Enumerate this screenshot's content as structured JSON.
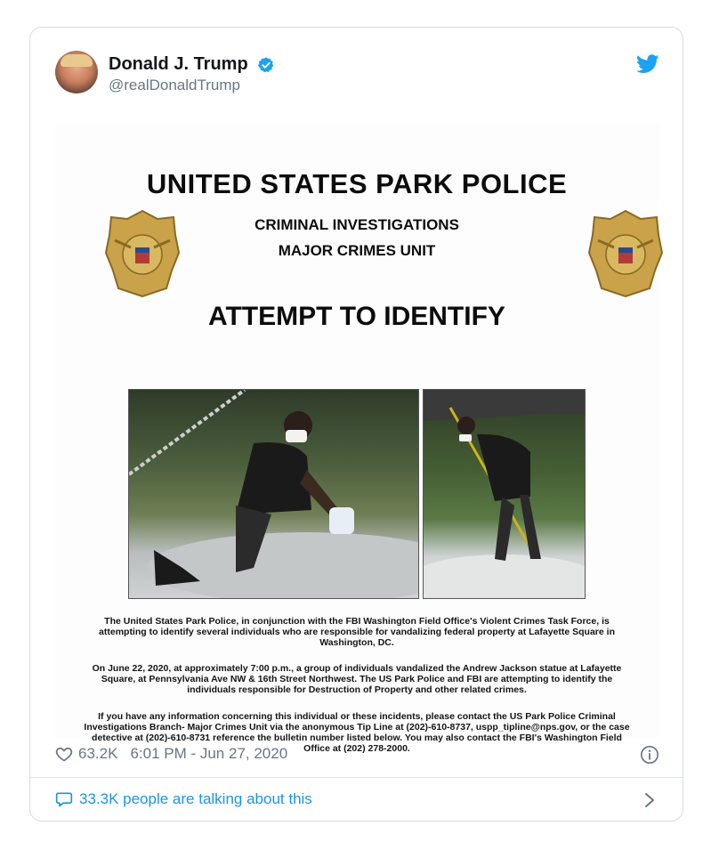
{
  "tweet": {
    "author_name": "Donald J. Trump",
    "handle": "@realDonaldTrump",
    "likes": "63.2K",
    "timestamp": "6:01 PM - Jun 27, 2020",
    "talking": "33.3K people are talking about this"
  },
  "poster": {
    "title": "UNITED STATES PARK POLICE",
    "subtitle1": "CRIMINAL INVESTIGATIONS",
    "subtitle2": "MAJOR CRIMES UNIT",
    "heading": "ATTEMPT TO IDENTIFY",
    "paragraph1": "The United States Park Police, in conjunction with the FBI Washington Field Office's Violent Crimes Task Force, is attempting to identify several individuals who are responsible for vandalizing federal property at Lafayette Square in Washington, DC.",
    "paragraph2": "On June 22, 2020, at approximately 7:00 p.m., a group of individuals vandalized the Andrew Jackson statue at Lafayette Square, at Pennsylvania Ave NW & 16th Street Northwest. The US Park Police and FBI are attempting to identify the individuals responsible for Destruction of Property and other related crimes.",
    "paragraph3": "If you have any information concerning this individual or these incidents, please contact the US Park Police Criminal Investigations Branch- Major Crimes Unit via the anonymous Tip Line at (202)-610-8737, uspp_tipline@nps.gov, or the case detective at (202)-610-8731 reference the bulletin number listed below. You may also contact the FBI's Washington Field Office at (202) 278-2000."
  },
  "colors": {
    "accent": "#1da1f2",
    "link": "#1b95e0",
    "muted": "#657786",
    "text": "#14171a",
    "badge_gold": "#c9a24a"
  },
  "icons": [
    "verified-badge-icon",
    "twitter-bird-icon",
    "heart-icon",
    "info-icon",
    "speech-bubble-icon",
    "chevron-right-icon"
  ]
}
